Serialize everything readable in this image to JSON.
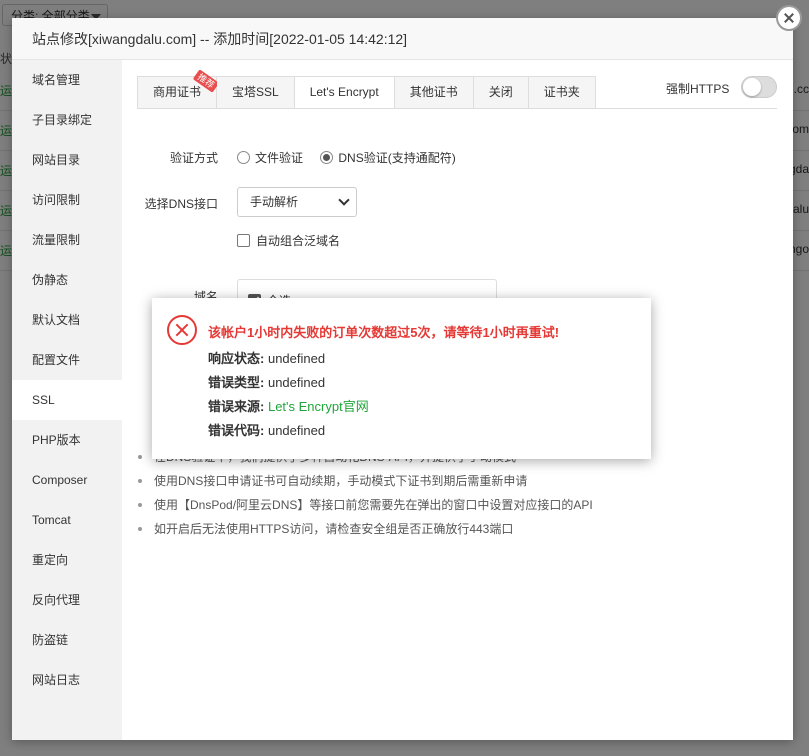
{
  "background": {
    "filter_label": "分类: 全部分类",
    "status_header": "状态",
    "rows": [
      {
        "status": "运行",
        "domain_tail": "alu.cc"
      },
      {
        "status": "运行",
        "domain_tail": "com"
      },
      {
        "status": "运行",
        "domain_tail": "ngda"
      },
      {
        "status": "运行",
        "domain_tail": "dalu"
      },
      {
        "status": "运行",
        "domain_tail": "ango"
      }
    ]
  },
  "modal": {
    "title": "站点修改[xiwangdalu.com] -- 添加时间[2022-01-05 14:42:12]",
    "sidebar": [
      {
        "label": "域名管理"
      },
      {
        "label": "子目录绑定"
      },
      {
        "label": "网站目录"
      },
      {
        "label": "访问限制"
      },
      {
        "label": "流量限制"
      },
      {
        "label": "伪静态"
      },
      {
        "label": "默认文档"
      },
      {
        "label": "配置文件"
      },
      {
        "label": "SSL",
        "active": true
      },
      {
        "label": "PHP版本"
      },
      {
        "label": "Composer"
      },
      {
        "label": "Tomcat"
      },
      {
        "label": "重定向"
      },
      {
        "label": "反向代理"
      },
      {
        "label": "防盗链"
      },
      {
        "label": "网站日志"
      }
    ],
    "tabs": [
      {
        "label": "商用证书",
        "badge": "推荐"
      },
      {
        "label": "宝塔SSL"
      },
      {
        "label": "Let's Encrypt",
        "active": true
      },
      {
        "label": "其他证书"
      },
      {
        "label": "关闭"
      },
      {
        "label": "证书夹"
      }
    ],
    "force_https_label": "强制HTTPS",
    "force_https_on": false,
    "verify_label": "验证方式",
    "verify_options": [
      "文件验证",
      "DNS验证(支持通配符)"
    ],
    "verify_selected": "DNS验证(支持通配符)",
    "dns_label": "选择DNS接口",
    "dns_value": "手动解析",
    "auto_wildcard_label": "自动组合泛域名",
    "auto_wildcard_checked": false,
    "domain_label": "域名",
    "select_all_label": "全选",
    "select_all_checked": true,
    "tips": [
      "在DNS验证中，我们提供了多种自动化DNS-API，并提供了手动模式",
      "使用DNS接口申请证书可自动续期，手动模式下证书到期后需重新申请",
      "使用【DnsPod/阿里云DNS】等接口前您需要先在弹出的窗口中设置对应接口的API",
      "如开启后无法使用HTTPS访问，请检查安全组是否正确放行443端口"
    ]
  },
  "error": {
    "title": "该帐户1小时内失败的订单次数超过5次，请等待1小时再重试!",
    "rows": [
      {
        "key": "响应状态:",
        "value": "undefined"
      },
      {
        "key": "错误类型:",
        "value": "undefined"
      },
      {
        "key": "错误来源:",
        "value": "Let's Encrypt官网"
      },
      {
        "key": "错误代码:",
        "value": "undefined"
      }
    ],
    "accent_color": "#e53935",
    "link_color": "#20a53a"
  }
}
